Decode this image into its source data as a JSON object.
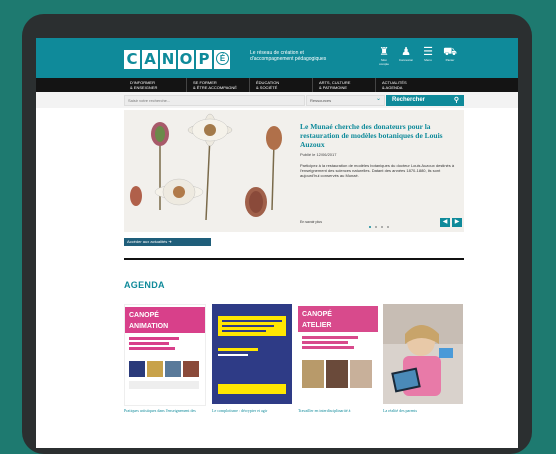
{
  "header": {
    "logo_letters": [
      "C",
      "A",
      "N",
      "O",
      "P"
    ],
    "logo_e": "É",
    "tagline": "Le réseau de création et d'accompagnement pédagogiques",
    "icons": [
      {
        "name": "account-icon",
        "label": "Mon compte"
      },
      {
        "name": "user-icon",
        "label": "Connexion"
      },
      {
        "name": "menu-icon",
        "label": "Menu"
      },
      {
        "name": "cart-icon",
        "label": "Panier"
      }
    ]
  },
  "nav": {
    "items": [
      "D'INFORMER\n& ENSEIGNER",
      "SE FORMER\n& ÊTRE ACCOMPAGNÉ",
      "ÉDUCATION\n& SOCIÉTÉ",
      "ARTS, CULTURE\n& PATRIMOINE",
      "ACTUALITÉS\n& AGENDA"
    ]
  },
  "search": {
    "placeholder": "Saisir votre recherche...",
    "select_value": "Ressources",
    "button_label": "Rechercher"
  },
  "slide": {
    "title": "Le Munaé cherche des donateurs pour la restauration de modèles botaniques de Louis Auzoux",
    "date": "Publié le 12/06/2017",
    "body": "Participez à la restauration de modèles botaniques du docteur Louis Auzoux destinés à l'enseignement des sciences naturelles. Datant des années 1870-1880, ils sont aujourd'hui conservés au Munaé.",
    "more": "En savoir plus"
  },
  "all_news_label": "Accéder aux actualités",
  "agenda": {
    "heading": "AGENDA",
    "cards": [
      {
        "title": "Pratiques artistiques dans l'enseignement des",
        "poster_lines": [
          "CANOPÉ",
          "ANIMATION"
        ]
      },
      {
        "title": "Le complotisme : décrypter et agir",
        "poster_lines": []
      },
      {
        "title": "Travailler en interdisciplinarité à",
        "poster_lines": [
          "CANOPÉ",
          "ATELIER"
        ]
      },
      {
        "title": "La réalité des parents",
        "poster_lines": []
      }
    ]
  },
  "colors": {
    "brand_teal": "#0f8a9a",
    "background": "#1e7a70",
    "navbar": "#141414",
    "animation_pink": "#e0447c",
    "atelier_pink": "#d84a8c"
  }
}
